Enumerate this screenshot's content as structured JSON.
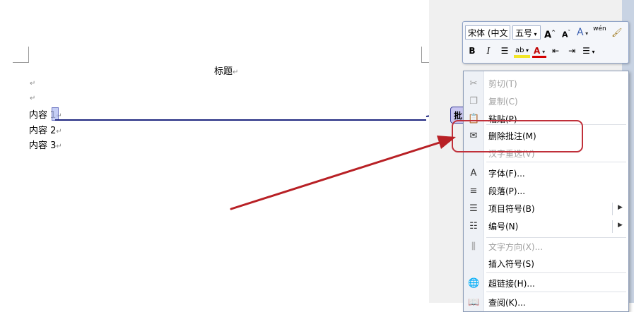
{
  "document": {
    "title": "标题",
    "lines": [
      "内容 1",
      "内容 2",
      "内容 3"
    ],
    "para_mark": "↵"
  },
  "comment_balloon": {
    "label": "批"
  },
  "mini_toolbar": {
    "font": "宋体 (中文",
    "size": "五号",
    "grow_font": "A",
    "shrink_font": "A",
    "styles": "A",
    "phonetic": "wén",
    "bold": "B",
    "italic": "I"
  },
  "context_menu": {
    "items": [
      {
        "label": "剪切(T)",
        "icon": "scissors-icon",
        "glyph": "✂",
        "disabled": true
      },
      {
        "label": "复制(C)",
        "icon": "copy-icon",
        "glyph": "❐",
        "disabled": true
      },
      {
        "label": "粘贴(P)",
        "icon": "paste-icon",
        "glyph": "📋",
        "disabled": false
      },
      {
        "label": "删除批注(M)",
        "icon": "delete-comment-icon",
        "glyph": "✉",
        "disabled": false
      },
      {
        "label": "汉字重选(V)",
        "icon": "",
        "glyph": "",
        "disabled": true
      },
      {
        "label": "字体(F)...",
        "icon": "font-icon",
        "glyph": "A",
        "disabled": false
      },
      {
        "label": "段落(P)...",
        "icon": "paragraph-icon",
        "glyph": "≡",
        "disabled": false
      },
      {
        "label": "项目符号(B)",
        "icon": "bullets-icon",
        "glyph": "☰",
        "disabled": false,
        "submenu": true
      },
      {
        "label": "编号(N)",
        "icon": "numbering-icon",
        "glyph": "☷",
        "disabled": false,
        "submenu": true
      },
      {
        "label": "文字方向(X)...",
        "icon": "text-direction-icon",
        "glyph": "⫼",
        "disabled": true
      },
      {
        "label": "插入符号(S)",
        "icon": "",
        "glyph": "",
        "disabled": false
      },
      {
        "label": "超链接(H)...",
        "icon": "hyperlink-icon",
        "glyph": "🌐",
        "disabled": false
      },
      {
        "label": "查阅(K)...",
        "icon": "lookup-icon",
        "glyph": "📖",
        "disabled": false
      }
    ]
  },
  "colors": {
    "highlight_box": "#c0303a",
    "arrow": "#b82025",
    "anchor_line": "#1e2680"
  }
}
